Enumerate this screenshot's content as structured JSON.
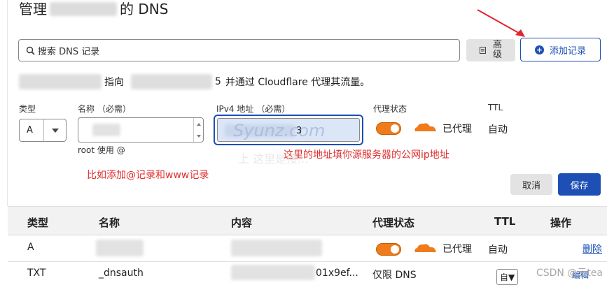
{
  "header": {
    "title_prefix": "管理",
    "title_suffix": "的 DNS"
  },
  "search": {
    "placeholder": "搜索 DNS 记录"
  },
  "buttons": {
    "advanced": "高级",
    "add_record": "添加记录",
    "cancel": "取消",
    "save": "保存"
  },
  "info": {
    "pointer_text": "指向",
    "tail_digit": "5",
    "suffix_text": "并通过 Cloudflare 代理其流量。"
  },
  "form": {
    "type_label": "类型",
    "type_value": "A",
    "name_label": "名称",
    "name_required": "（必需）",
    "name_hint": "root 使用 @",
    "ipv4_label": "IPv4 地址",
    "ipv4_required": "（必需）",
    "ipv4_watermark": "Syunz.com",
    "ipv4_tail": "3",
    "proxy_label": "代理状态",
    "proxy_value": "已代理",
    "ttl_label": "TTL",
    "ttl_value": "自动"
  },
  "annotations": {
    "ip_note": "这里的地址填你源服务器的公网ip地址",
    "add_note": "比如添加@记录和www记录",
    "faint_text": "上 这里是接..."
  },
  "table": {
    "headers": {
      "type": "类型",
      "name": "名称",
      "content": "内容",
      "proxy": "代理状态",
      "ttl": "TTL",
      "actions": "操作"
    },
    "rows": [
      {
        "type": "A",
        "name": "",
        "content": "",
        "proxy": "已代理",
        "ttl": "自动",
        "action": "删除"
      },
      {
        "type": "TXT",
        "name": "_dnsauth",
        "content": "01x9ef...",
        "proxy": "仅限 DNS",
        "ttl": "自▼",
        "action": "编辑"
      }
    ]
  },
  "watermark": "CSDN @云tea",
  "colors": {
    "accent": "#1d4fb5",
    "proxy_orange": "#ef7b1b",
    "annotation_red": "#e02d2d",
    "arrow_red": "#e0262d"
  }
}
